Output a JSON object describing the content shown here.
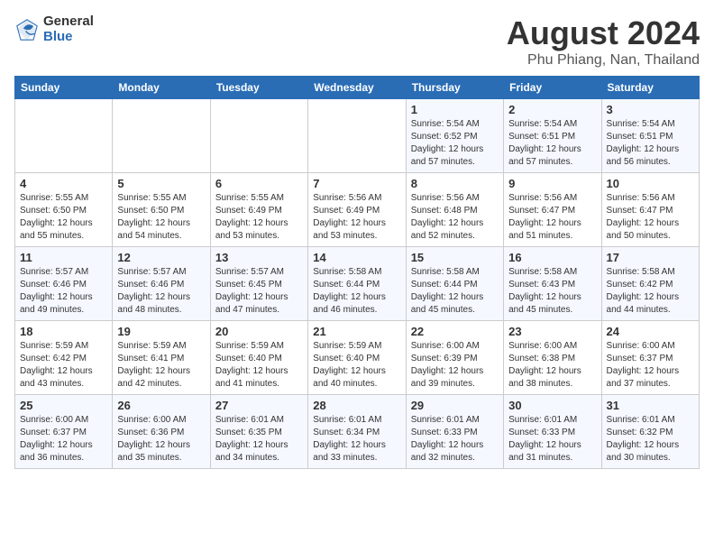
{
  "logo": {
    "general": "General",
    "blue": "Blue"
  },
  "title": "August 2024",
  "location": "Phu Phiang, Nan, Thailand",
  "days_of_week": [
    "Sunday",
    "Monday",
    "Tuesday",
    "Wednesday",
    "Thursday",
    "Friday",
    "Saturday"
  ],
  "weeks": [
    [
      {
        "day": "",
        "info": ""
      },
      {
        "day": "",
        "info": ""
      },
      {
        "day": "",
        "info": ""
      },
      {
        "day": "",
        "info": ""
      },
      {
        "day": "1",
        "info": "Sunrise: 5:54 AM\nSunset: 6:52 PM\nDaylight: 12 hours\nand 57 minutes."
      },
      {
        "day": "2",
        "info": "Sunrise: 5:54 AM\nSunset: 6:51 PM\nDaylight: 12 hours\nand 57 minutes."
      },
      {
        "day": "3",
        "info": "Sunrise: 5:54 AM\nSunset: 6:51 PM\nDaylight: 12 hours\nand 56 minutes."
      }
    ],
    [
      {
        "day": "4",
        "info": "Sunrise: 5:55 AM\nSunset: 6:50 PM\nDaylight: 12 hours\nand 55 minutes."
      },
      {
        "day": "5",
        "info": "Sunrise: 5:55 AM\nSunset: 6:50 PM\nDaylight: 12 hours\nand 54 minutes."
      },
      {
        "day": "6",
        "info": "Sunrise: 5:55 AM\nSunset: 6:49 PM\nDaylight: 12 hours\nand 53 minutes."
      },
      {
        "day": "7",
        "info": "Sunrise: 5:56 AM\nSunset: 6:49 PM\nDaylight: 12 hours\nand 53 minutes."
      },
      {
        "day": "8",
        "info": "Sunrise: 5:56 AM\nSunset: 6:48 PM\nDaylight: 12 hours\nand 52 minutes."
      },
      {
        "day": "9",
        "info": "Sunrise: 5:56 AM\nSunset: 6:47 PM\nDaylight: 12 hours\nand 51 minutes."
      },
      {
        "day": "10",
        "info": "Sunrise: 5:56 AM\nSunset: 6:47 PM\nDaylight: 12 hours\nand 50 minutes."
      }
    ],
    [
      {
        "day": "11",
        "info": "Sunrise: 5:57 AM\nSunset: 6:46 PM\nDaylight: 12 hours\nand 49 minutes."
      },
      {
        "day": "12",
        "info": "Sunrise: 5:57 AM\nSunset: 6:46 PM\nDaylight: 12 hours\nand 48 minutes."
      },
      {
        "day": "13",
        "info": "Sunrise: 5:57 AM\nSunset: 6:45 PM\nDaylight: 12 hours\nand 47 minutes."
      },
      {
        "day": "14",
        "info": "Sunrise: 5:58 AM\nSunset: 6:44 PM\nDaylight: 12 hours\nand 46 minutes."
      },
      {
        "day": "15",
        "info": "Sunrise: 5:58 AM\nSunset: 6:44 PM\nDaylight: 12 hours\nand 45 minutes."
      },
      {
        "day": "16",
        "info": "Sunrise: 5:58 AM\nSunset: 6:43 PM\nDaylight: 12 hours\nand 45 minutes."
      },
      {
        "day": "17",
        "info": "Sunrise: 5:58 AM\nSunset: 6:42 PM\nDaylight: 12 hours\nand 44 minutes."
      }
    ],
    [
      {
        "day": "18",
        "info": "Sunrise: 5:59 AM\nSunset: 6:42 PM\nDaylight: 12 hours\nand 43 minutes."
      },
      {
        "day": "19",
        "info": "Sunrise: 5:59 AM\nSunset: 6:41 PM\nDaylight: 12 hours\nand 42 minutes."
      },
      {
        "day": "20",
        "info": "Sunrise: 5:59 AM\nSunset: 6:40 PM\nDaylight: 12 hours\nand 41 minutes."
      },
      {
        "day": "21",
        "info": "Sunrise: 5:59 AM\nSunset: 6:40 PM\nDaylight: 12 hours\nand 40 minutes."
      },
      {
        "day": "22",
        "info": "Sunrise: 6:00 AM\nSunset: 6:39 PM\nDaylight: 12 hours\nand 39 minutes."
      },
      {
        "day": "23",
        "info": "Sunrise: 6:00 AM\nSunset: 6:38 PM\nDaylight: 12 hours\nand 38 minutes."
      },
      {
        "day": "24",
        "info": "Sunrise: 6:00 AM\nSunset: 6:37 PM\nDaylight: 12 hours\nand 37 minutes."
      }
    ],
    [
      {
        "day": "25",
        "info": "Sunrise: 6:00 AM\nSunset: 6:37 PM\nDaylight: 12 hours\nand 36 minutes."
      },
      {
        "day": "26",
        "info": "Sunrise: 6:00 AM\nSunset: 6:36 PM\nDaylight: 12 hours\nand 35 minutes."
      },
      {
        "day": "27",
        "info": "Sunrise: 6:01 AM\nSunset: 6:35 PM\nDaylight: 12 hours\nand 34 minutes."
      },
      {
        "day": "28",
        "info": "Sunrise: 6:01 AM\nSunset: 6:34 PM\nDaylight: 12 hours\nand 33 minutes."
      },
      {
        "day": "29",
        "info": "Sunrise: 6:01 AM\nSunset: 6:33 PM\nDaylight: 12 hours\nand 32 minutes."
      },
      {
        "day": "30",
        "info": "Sunrise: 6:01 AM\nSunset: 6:33 PM\nDaylight: 12 hours\nand 31 minutes."
      },
      {
        "day": "31",
        "info": "Sunrise: 6:01 AM\nSunset: 6:32 PM\nDaylight: 12 hours\nand 30 minutes."
      }
    ]
  ]
}
